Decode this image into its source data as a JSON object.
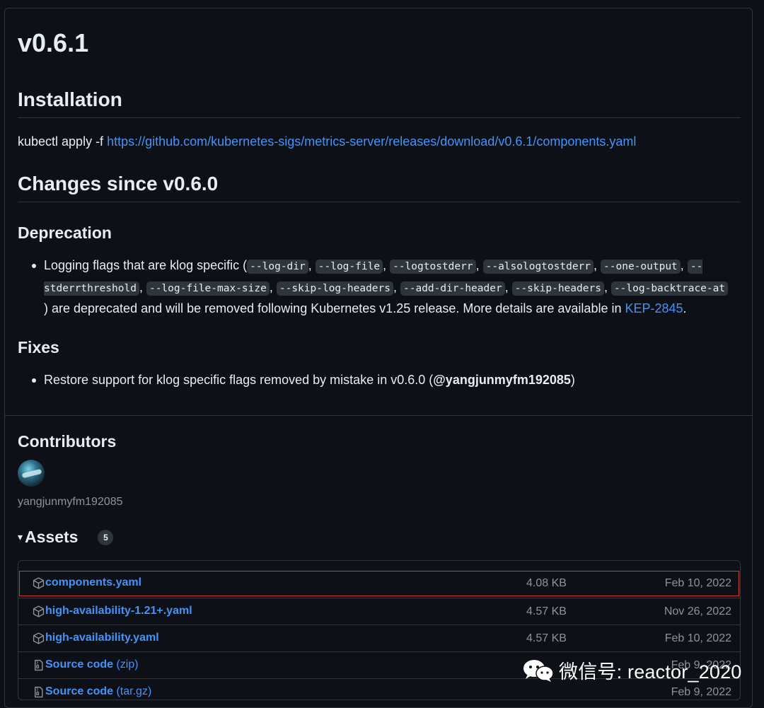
{
  "release": {
    "title": "v0.6.1"
  },
  "installation": {
    "heading": "Installation",
    "command": "kubectl apply -f",
    "url": "https://github.com/kubernetes-sigs/metrics-server/releases/download/v0.6.1/components.yaml"
  },
  "changes": {
    "heading": "Changes since v0.6.0",
    "deprecation": {
      "heading": "Deprecation",
      "text_before": "Logging flags that are klog specific (",
      "flags": [
        "--log-dir",
        "--log-file",
        "--logtostderr",
        "--alsologtostderr",
        "--one-output",
        "--stderrthreshold",
        "--log-file-max-size",
        "--skip-log-headers",
        "--add-dir-header",
        "--skip-headers",
        "--log-backtrace-at"
      ],
      "text_after": ") are deprecated and will be removed following Kubernetes v1.25 release. More details are available in",
      "link": "KEP-2845",
      "end": "."
    },
    "fixes": {
      "heading": "Fixes",
      "text": "Restore support for klog specific flags removed by mistake in v0.6.0 (",
      "mention": "@yangjunmyfm192085",
      "end": ")"
    }
  },
  "contributors": {
    "heading": "Contributors",
    "names": [
      "yangjunmyfm192085"
    ]
  },
  "assets": {
    "caret": "▾",
    "heading": "Assets",
    "count": "5",
    "rows": [
      {
        "name": "components.yaml",
        "suffix": "",
        "size": "4.08 KB",
        "date": "Feb 10, 2022",
        "icon": "package-icon"
      },
      {
        "name": "high-availability-1.21+.yaml",
        "suffix": "",
        "size": "4.57 KB",
        "date": "Nov 26, 2022",
        "icon": "package-icon"
      },
      {
        "name": "high-availability.yaml",
        "suffix": "",
        "size": "4.57 KB",
        "date": "Feb 10, 2022",
        "icon": "package-icon"
      },
      {
        "name": "Source code",
        "suffix": " (zip)",
        "size": "",
        "date": "Feb 9, 2022",
        "icon": "file-zip-icon"
      },
      {
        "name": "Source code",
        "suffix": " (tar.gz)",
        "size": "",
        "date": "Feb 9, 2022",
        "icon": "file-zip-icon"
      }
    ]
  },
  "watermark": {
    "text": "微信号: reactor_2020"
  },
  "colors": {
    "background": "#0d1117",
    "link": "#4493f8",
    "muted": "#8b949e",
    "border": "#30363d",
    "highlight": "#d63a3a"
  }
}
